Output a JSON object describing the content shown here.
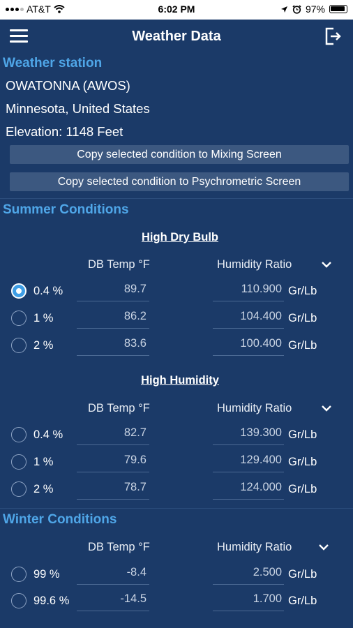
{
  "status_bar": {
    "carrier": "AT&T",
    "time": "6:02 PM",
    "battery": "97%"
  },
  "nav": {
    "title": "Weather Data"
  },
  "station": {
    "heading": "Weather station",
    "name": "OWATONNA (AWOS)",
    "location": "Minnesota, United States",
    "elevation": "Elevation: 1148 Feet"
  },
  "buttons": {
    "copy_mixing": "Copy selected condition to Mixing Screen",
    "copy_psychrometric": "Copy selected condition to Psychrometric Screen"
  },
  "summer": {
    "heading": "Summer Conditions",
    "dry_bulb": {
      "heading": "High Dry Bulb",
      "col_db": "DB Temp °F",
      "col_hr": "Humidity Ratio",
      "rows": [
        {
          "label": "0.4 %",
          "db": "89.7",
          "hr": "110.900",
          "unit": "Gr/Lb",
          "selected": true
        },
        {
          "label": "1 %",
          "db": "86.2",
          "hr": "104.400",
          "unit": "Gr/Lb",
          "selected": false
        },
        {
          "label": "2 %",
          "db": "83.6",
          "hr": "100.400",
          "unit": "Gr/Lb",
          "selected": false
        }
      ]
    },
    "humidity": {
      "heading": "High Humidity",
      "col_db": "DB Temp °F",
      "col_hr": "Humidity Ratio",
      "rows": [
        {
          "label": "0.4 %",
          "db": "82.7",
          "hr": "139.300",
          "unit": "Gr/Lb",
          "selected": false
        },
        {
          "label": "1 %",
          "db": "79.6",
          "hr": "129.400",
          "unit": "Gr/Lb",
          "selected": false
        },
        {
          "label": "2 %",
          "db": "78.7",
          "hr": "124.000",
          "unit": "Gr/Lb",
          "selected": false
        }
      ]
    }
  },
  "winter": {
    "heading": "Winter Conditions",
    "col_db": "DB Temp °F",
    "col_hr": "Humidity Ratio",
    "rows": [
      {
        "label": "99 %",
        "db": "-8.4",
        "hr": "2.500",
        "unit": "Gr/Lb",
        "selected": false
      },
      {
        "label": "99.6 %",
        "db": "-14.5",
        "hr": "1.700",
        "unit": "Gr/Lb",
        "selected": false
      }
    ]
  },
  "colors": {
    "background": "#1b3a68",
    "section_title": "#4fa6e8",
    "button": "#3c5880",
    "radio_selected": "#3e9ee6"
  }
}
